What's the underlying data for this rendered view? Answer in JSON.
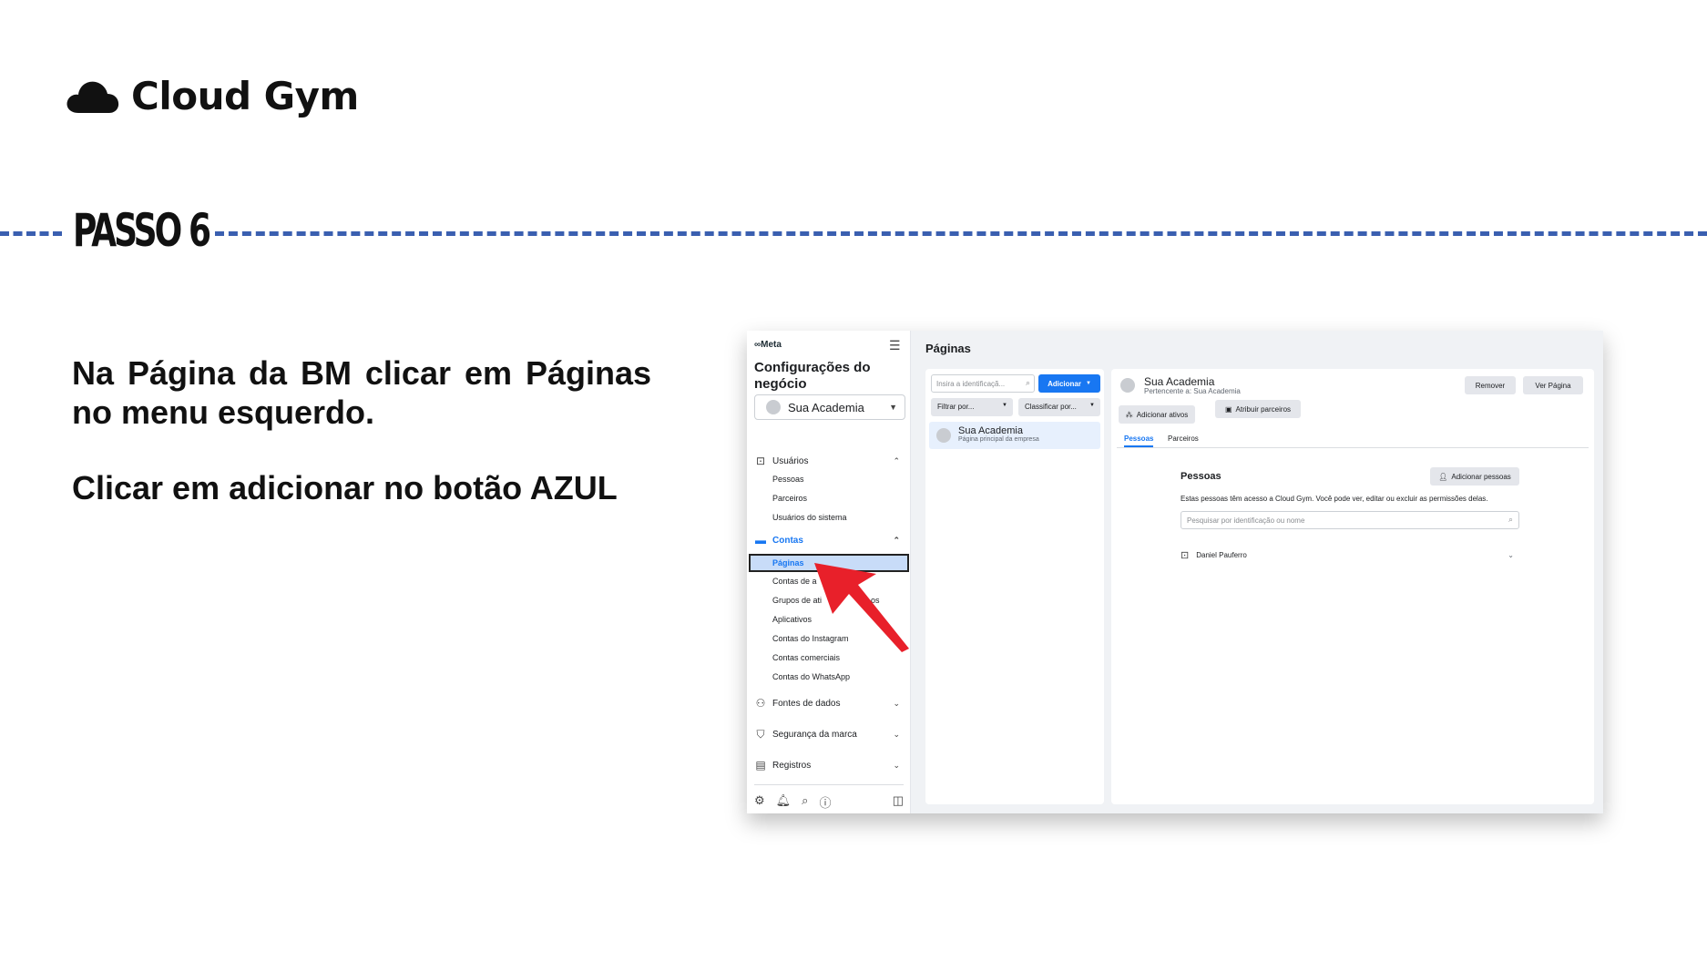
{
  "brand": {
    "name": "Cloud Gym",
    "icon": "cloud-icon"
  },
  "step": {
    "title": "PASSO 6",
    "line_color": "#3a5fb0"
  },
  "instructions": [
    "Na Página da BM clicar em Páginas no menu esquerdo.",
    "Clicar em adicionar no botão AZUL"
  ],
  "bm": {
    "meta_logo": "∞Meta",
    "sidebar_title": "Configurações do negócio",
    "account": "Sua Academia",
    "sections": {
      "usuarios": {
        "label": "Usuários",
        "icon": "users-icon",
        "items": [
          "Pessoas",
          "Parceiros",
          "Usuários do sistema"
        ]
      },
      "contas": {
        "label": "Contas",
        "icon": "accounts-icon",
        "items": [
          "Páginas",
          "Contas de a",
          "Grupos de ati",
          "os",
          "Aplicativos",
          "Contas do Instagram",
          "Contas comerciais",
          "Contas do WhatsApp"
        ]
      },
      "fontes": {
        "label": "Fontes de dados",
        "icon": "data-sources-icon"
      },
      "seguranca": {
        "label": "Segurança da marca",
        "icon": "shield-icon"
      },
      "registros": {
        "label": "Registros",
        "icon": "logs-icon"
      }
    },
    "content_title": "Páginas",
    "search_placeholder": "Insira a identificaçã...",
    "add_button": "Adicionar",
    "filter": "Filtrar por...",
    "sort": "Classificar por...",
    "page_item": {
      "name": "Sua Academia",
      "desc": "Página principal da empresa"
    },
    "detail": {
      "name": "Sua Academia",
      "owner": "Pertencente a: Sua Academia",
      "remove": "Remover",
      "view_page": "Ver Página",
      "add_assets": "Adicionar ativos",
      "assign_partners": "Atribuir parceiros",
      "tabs": [
        "Pessoas",
        "Parceiros"
      ],
      "people_title": "Pessoas",
      "add_people": "Adicionar pessoas",
      "people_desc": "Estas pessoas têm acesso a Cloud Gym. Você pode ver, editar ou excluir as permissões delas.",
      "people_search": "Pesquisar por identificação ou nome",
      "person": "Daniel Pauferro"
    },
    "accent_color": "#1877f2",
    "arrow_color": "#e8202a"
  }
}
